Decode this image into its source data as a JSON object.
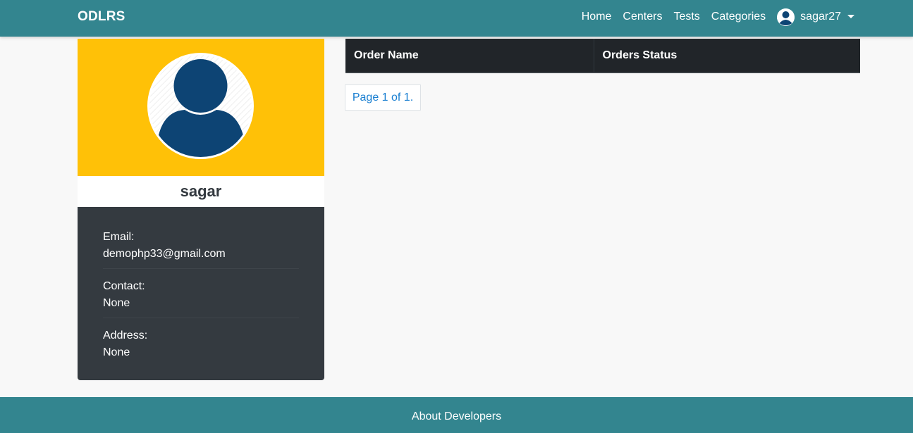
{
  "navbar": {
    "brand": "ODLRS",
    "links": [
      "Home",
      "Centers",
      "Tests",
      "Categories"
    ],
    "username": "sagar27",
    "user_icon": "user-circle-icon",
    "dropdown_icon": "caret-down-icon"
  },
  "profile": {
    "avatar_icon": "user-avatar-icon",
    "name": "sagar",
    "email_label": "Email:",
    "email": "demophp33@gmail.com",
    "contact_label": "Contact:",
    "contact": "None",
    "address_label": "Address:",
    "address": "None"
  },
  "orders": {
    "headers": [
      "Order Name",
      "Orders Status"
    ],
    "rows": [],
    "pagination": "Page 1 of 1."
  },
  "footer": {
    "link": "About Developers"
  },
  "colors": {
    "navbar_bg": "#33858f",
    "banner_bg": "#ffc107",
    "info_bg": "#343a40",
    "table_head_bg": "#212529",
    "avatar_fill": "#0d4474",
    "link_blue": "#1a7fd1"
  }
}
